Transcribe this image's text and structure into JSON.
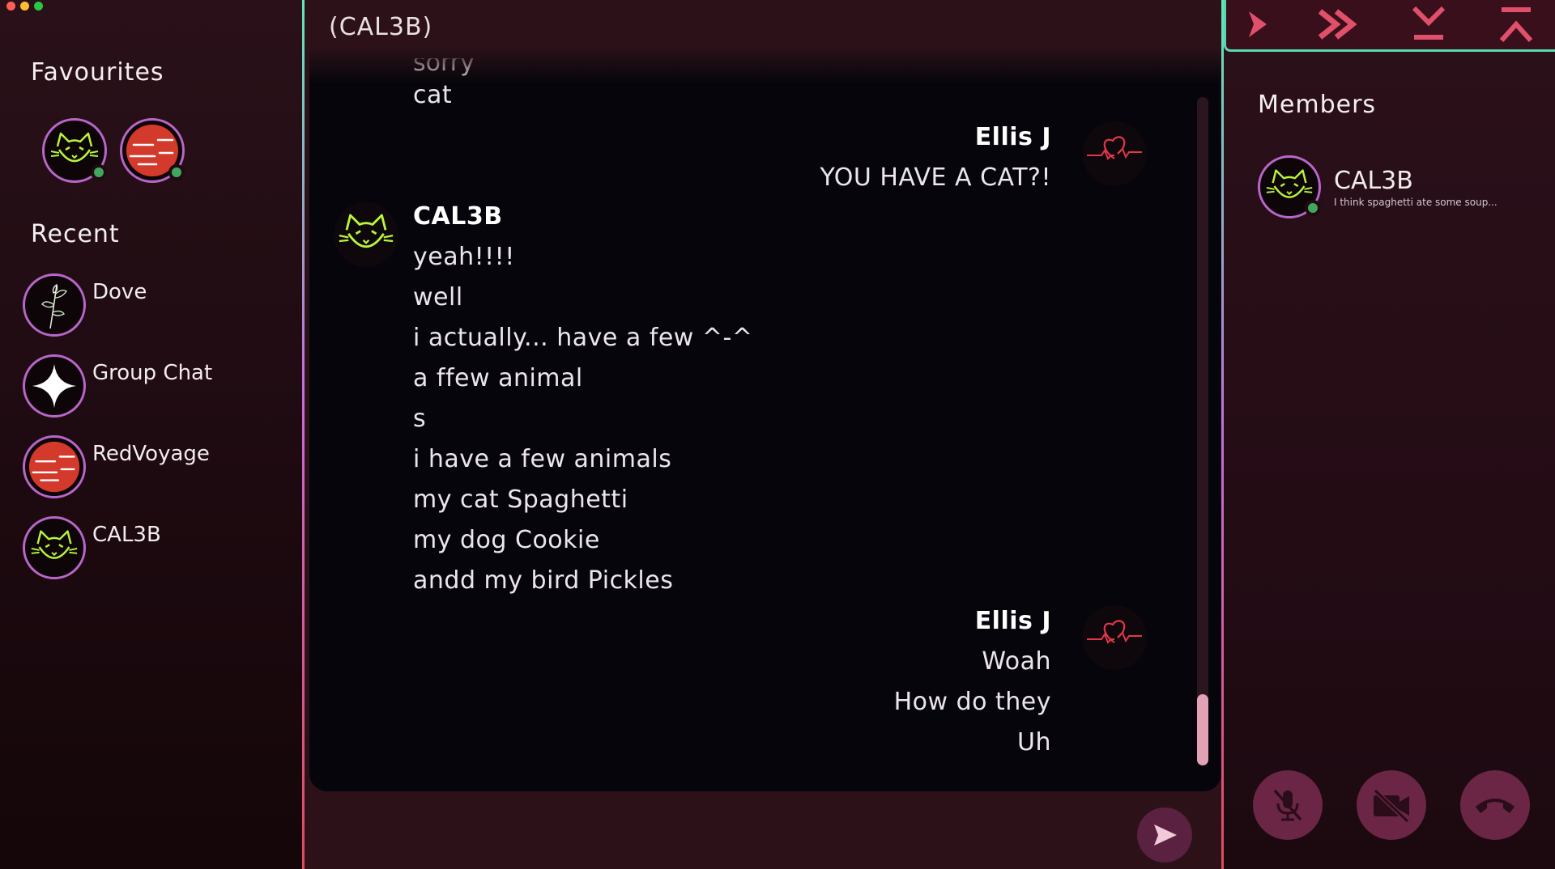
{
  "window": {
    "controls": [
      "close",
      "minimize",
      "maximize"
    ]
  },
  "sidebar": {
    "favourites_title": "Favourites",
    "favourites": [
      {
        "avatar": "cat-icon",
        "online": true
      },
      {
        "avatar": "red-planet-icon",
        "online": true
      }
    ],
    "recent_title": "Recent",
    "recent": [
      {
        "label": "Dove",
        "avatar": "plant-sketch-icon"
      },
      {
        "label": "Group Chat",
        "avatar": "sparkle-star-icon"
      },
      {
        "label": "RedVoyage",
        "avatar": "red-planet-icon"
      },
      {
        "label": "CAL3B",
        "avatar": "cat-icon"
      }
    ]
  },
  "chat": {
    "title": "(CAL3B)",
    "partial_line": "sorry",
    "messages": [
      {
        "sender": "",
        "align": "left",
        "lines": [
          "cat"
        ]
      },
      {
        "sender": "Ellis J",
        "align": "right",
        "avatar": "heartbeat-icon",
        "lines": [
          "YOU HAVE A CAT?!"
        ]
      },
      {
        "sender": "CAL3B",
        "align": "left",
        "avatar": "cat-icon",
        "lines": [
          "yeah!!!!",
          "well",
          "i actually... have a few ^-^",
          "a ffew animal",
          "s",
          "i have a few animals",
          "my cat Spaghetti",
          "my dog Cookie",
          "andd my bird Pickles"
        ]
      },
      {
        "sender": "Ellis J",
        "align": "right",
        "avatar": "heartbeat-icon",
        "lines": [
          "Woah",
          "How do they",
          "Uh"
        ]
      }
    ],
    "send_icon": "send-icon"
  },
  "toolbar": {
    "buttons": [
      "chevron-right-icon",
      "double-chevron-right-icon",
      "collapse-down-icon",
      "collapse-up-icon"
    ]
  },
  "members": {
    "title": "Members",
    "list": [
      {
        "name": "CAL3B",
        "status": "I think spaghetti ate some soup...",
        "online": true,
        "avatar": "cat-icon"
      }
    ]
  },
  "call_controls": [
    "mic-off-icon",
    "camera-off-icon",
    "hang-up-icon"
  ],
  "colors": {
    "accent_pink": "#e0506a",
    "accent_teal": "#5fe7b6",
    "accent_purple": "#c36ed9",
    "online_green": "#3fa85c",
    "chat_background": "#06050b"
  }
}
